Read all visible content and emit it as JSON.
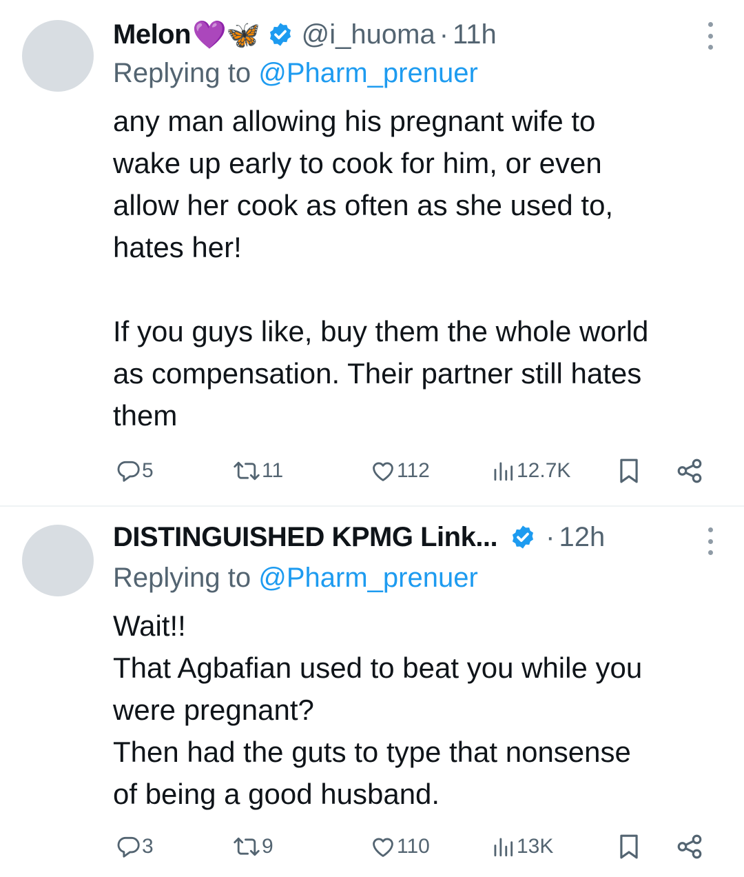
{
  "tweets": [
    {
      "name": "Melon",
      "emojis": "💜🦋",
      "verified": true,
      "handle": "@i_huoma",
      "separator": "·",
      "time": "11h",
      "replying_prefix": "Replying to",
      "replying_handle": "@Pharm_prenuer",
      "text_lines": [
        "any man allowing his pregnant wife to",
        "wake up early to cook for him, or even",
        "allow her cook as often as she used to,",
        "hates her!",
        "",
        "If you guys like, buy them the whole world",
        "as compensation. Their partner still hates",
        "them"
      ],
      "replies": "5",
      "reposts": "11",
      "likes": "112",
      "views": "12.7K"
    },
    {
      "name": "DISTINGUISHED KPMG Link...",
      "verified": true,
      "separator": "·",
      "time": "12h",
      "replying_prefix": "Replying to",
      "replying_handle": "@Pharm_prenuer",
      "text_lines": [
        "Wait!!",
        "That Agbafian used to beat you while you",
        "were pregnant?",
        "Then had the guts to type that nonsense",
        "of being a good husband."
      ],
      "replies": "3",
      "reposts": "9",
      "likes": "110",
      "views": "13K"
    }
  ],
  "icons": {
    "reply": "reply-icon",
    "repost": "repost-icon",
    "like": "heart-icon",
    "views": "views-icon",
    "bookmark": "bookmark-icon",
    "share": "share-icon",
    "more": "more-icon",
    "verified": "verified-badge-icon"
  },
  "colors": {
    "text": "#0f1419",
    "secondary": "#536471",
    "link": "#1d9bf0",
    "verified": "#1d9bf0",
    "avatar": "#d8dde2"
  }
}
